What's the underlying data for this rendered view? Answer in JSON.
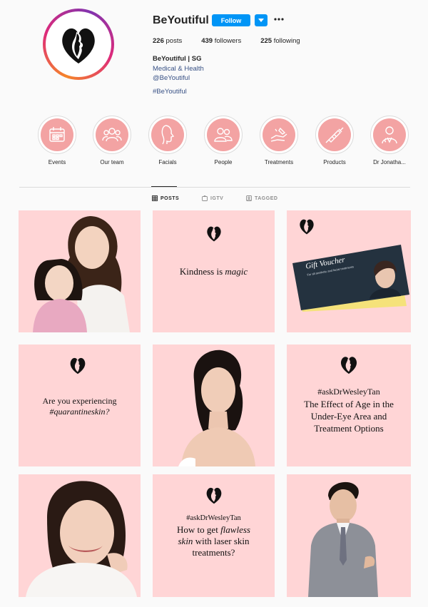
{
  "profile": {
    "username": "BeYoutiful",
    "follow_label": "Follow",
    "posts_count": "226",
    "posts_label": "posts",
    "followers_count": "439",
    "followers_label": "followers",
    "following_count": "225",
    "following_label": "following",
    "full_name": "BeYoutiful | SG",
    "category": "Medical & Health",
    "mention": "@BeYoutiful",
    "hashtag": "#BeYoutiful"
  },
  "highlights": [
    {
      "label": "Events",
      "icon": "calendar-icon"
    },
    {
      "label": "Our team",
      "icon": "team-icon"
    },
    {
      "label": "Facials",
      "icon": "face-profile-icon"
    },
    {
      "label": "People",
      "icon": "people-icon"
    },
    {
      "label": "Treatments",
      "icon": "hand-cream-icon"
    },
    {
      "label": "Products",
      "icon": "syringe-icon"
    },
    {
      "label": "Dr Jonatha...",
      "icon": "doctor-icon"
    }
  ],
  "tabs": [
    {
      "label": "POSTS",
      "icon": "grid-icon",
      "active": true
    },
    {
      "label": "IGTV",
      "icon": "igtv-icon",
      "active": false
    },
    {
      "label": "TAGGED",
      "icon": "tag-icon",
      "active": false
    }
  ],
  "posts": {
    "p2_text": "Kindness is ",
    "p2_em": "magic",
    "p3_title": "Gift Voucher",
    "p3_sub": "For all aesthetic and facial treatments",
    "p4_line1": "Are you experiencing",
    "p4_line2": "#quarantineskin?",
    "p6_line1": "#askDrWesleyTan",
    "p6_line2": "The Effect of Age in the",
    "p6_line3": "Under-Eye Area and",
    "p6_line4": "Treatment Options",
    "p8_line1": "#askDrWesleyTan",
    "p8_line2a": "How to get ",
    "p8_line2b": "flawless",
    "p8_line3a": "skin",
    "p8_line3b": " with laser skin",
    "p8_line4": "treatments?"
  },
  "colors": {
    "accent": "#0095f6",
    "post_bg": "#ffd5d6",
    "highlight_bg": "#f3a3a3",
    "link": "#385185"
  }
}
